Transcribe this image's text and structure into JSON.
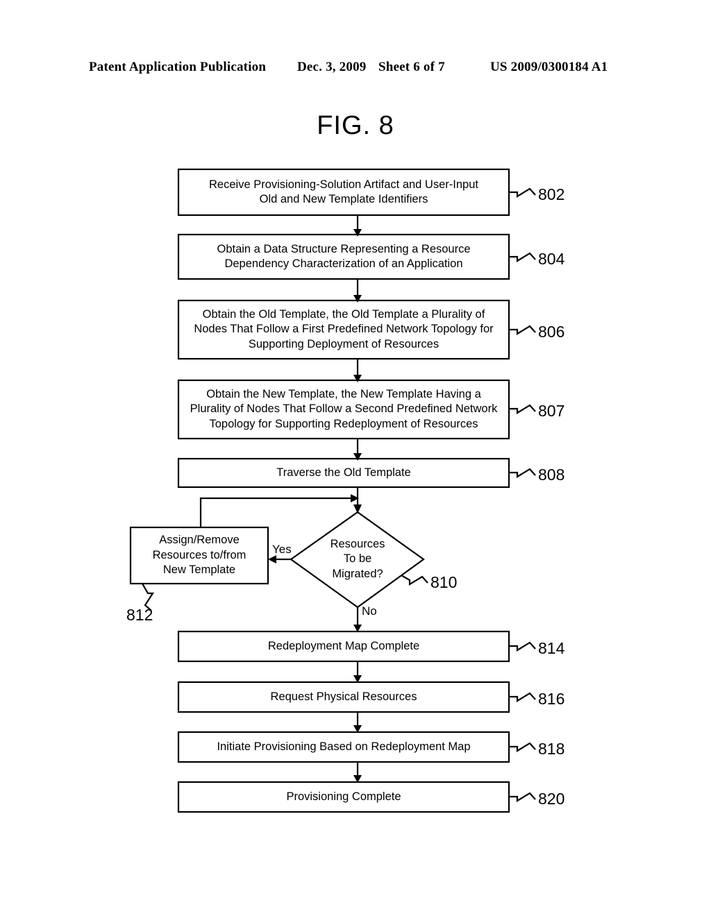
{
  "header": {
    "publication": "Patent Application Publication",
    "date": "Dec. 3, 2009",
    "sheet": "Sheet 6 of 7",
    "patent_number": "US 2009/0300184 A1"
  },
  "figure": {
    "title": "FIG. 8"
  },
  "flowchart": {
    "nodes": [
      {
        "id": "802",
        "shape": "process",
        "label": "Receive Provisioning-Solution Artifact and User-Input\nOld and New Template Identifiers",
        "ref": "802"
      },
      {
        "id": "804",
        "shape": "process",
        "label": "Obtain a Data Structure Representing a Resource\nDependency Characterization of an Application",
        "ref": "804"
      },
      {
        "id": "806",
        "shape": "process",
        "label": "Obtain the Old Template, the Old Template a Plurality of\nNodes That Follow a First Predefined Network Topology for\nSupporting Deployment of Resources",
        "ref": "806"
      },
      {
        "id": "807",
        "shape": "process",
        "label": "Obtain the New Template, the New Template Having a\nPlurality of Nodes That Follow a Second Predefined Network\nTopology for Supporting Redeployment of Resources",
        "ref": "807"
      },
      {
        "id": "808",
        "shape": "process",
        "label": "Traverse the Old Template",
        "ref": "808"
      },
      {
        "id": "810",
        "shape": "decision",
        "label": "Resources\nTo be\nMigrated?",
        "ref": "810"
      },
      {
        "id": "812",
        "shape": "process",
        "label": "Assign/Remove\nResources to/from\nNew Template",
        "ref": "812"
      },
      {
        "id": "814",
        "shape": "process",
        "label": "Redeployment Map Complete",
        "ref": "814"
      },
      {
        "id": "816",
        "shape": "process",
        "label": "Request Physical Resources",
        "ref": "816"
      },
      {
        "id": "818",
        "shape": "process",
        "label": "Initiate Provisioning Based on Redeployment Map",
        "ref": "818"
      },
      {
        "id": "820",
        "shape": "process",
        "label": "Provisioning Complete",
        "ref": "820"
      }
    ],
    "edge_labels": {
      "yes": "Yes",
      "no": "No"
    },
    "colors": {
      "stroke": "#000000",
      "background": "#ffffff"
    }
  }
}
